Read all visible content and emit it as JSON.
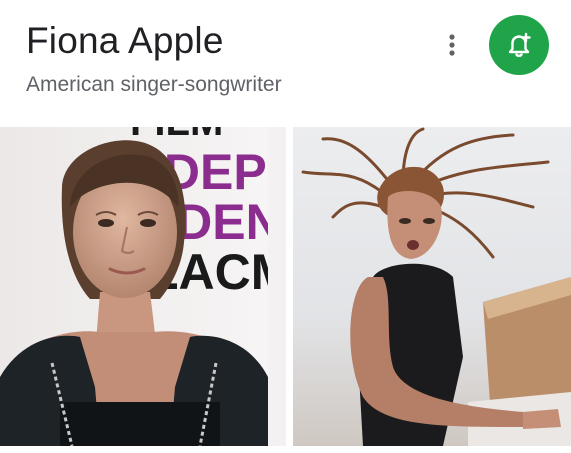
{
  "entity": {
    "name": "Fiona Apple",
    "description": "American singer-songwriter"
  },
  "actions": {
    "more_icon": "more-vert-icon",
    "follow_icon": "bell-plus-icon",
    "follow_color": "#1fa44a"
  },
  "photos": {
    "backdrop_text_lines": [
      "FILM",
      "IDEP",
      "NDENT",
      "LACMA"
    ],
    "backdrop_accent": "#8b2d8e"
  }
}
